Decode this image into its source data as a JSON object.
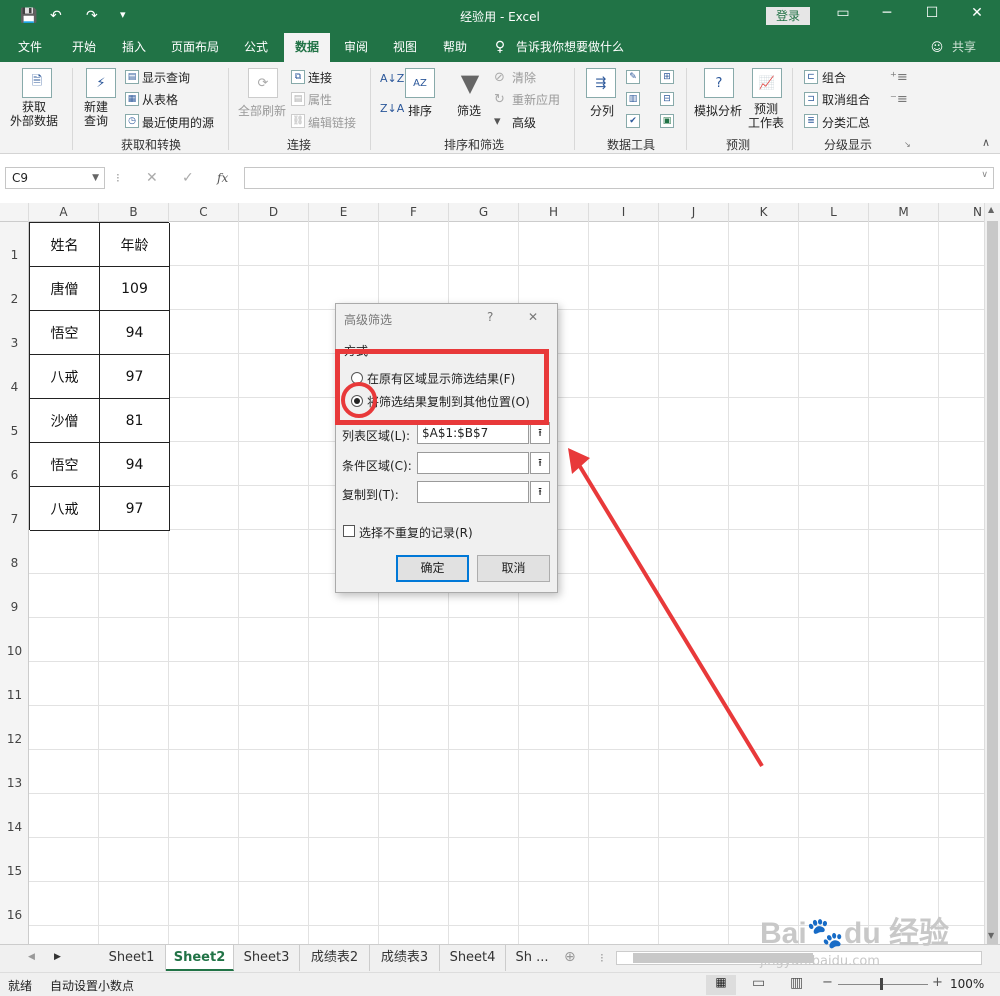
{
  "window": {
    "title": "经验用 - Excel",
    "login": "登录"
  },
  "tabs": [
    "文件",
    "开始",
    "插入",
    "页面布局",
    "公式",
    "数据",
    "审阅",
    "视图",
    "帮助"
  ],
  "tell_me": "告诉我你想要做什么",
  "share": "共享",
  "ribbon": {
    "get_external": "获取\n外部数据",
    "new_query": "新建\n查询",
    "show_queries": "显示查询",
    "from_table": "从表格",
    "recent_sources": "最近使用的源",
    "group_get_transform": "获取和转换",
    "refresh_all": "全部刷新",
    "connections": "连接",
    "properties": "属性",
    "edit_links": "编辑链接",
    "group_connections": "连接",
    "sort": "排序",
    "filter": "筛选",
    "clear": "清除",
    "reapply": "重新应用",
    "advanced": "高级",
    "group_sort_filter": "排序和筛选",
    "text_to_columns": "分列",
    "group_data_tools": "数据工具",
    "what_if": "模拟分析",
    "forecast_sheet": "预测\n工作表",
    "group_forecast": "预测",
    "group": "组合",
    "ungroup": "取消组合",
    "subtotal": "分类汇总",
    "group_outline": "分级显示"
  },
  "formula_bar": {
    "name_box": "C9",
    "fx": "fx",
    "value": ""
  },
  "columns": [
    "A",
    "B",
    "C",
    "D",
    "E",
    "F",
    "G",
    "H",
    "I",
    "J",
    "K",
    "L",
    "M",
    "N"
  ],
  "rows": [
    "1",
    "2",
    "3",
    "4",
    "5",
    "6",
    "7",
    "8",
    "9",
    "10",
    "11",
    "12",
    "13",
    "14",
    "15",
    "16"
  ],
  "table": {
    "headers": [
      "姓名",
      "年龄"
    ],
    "rows": [
      [
        "唐僧",
        "109"
      ],
      [
        "悟空",
        "94"
      ],
      [
        "八戒",
        "97"
      ],
      [
        "沙僧",
        "81"
      ],
      [
        "悟空",
        "94"
      ],
      [
        "八戒",
        "97"
      ]
    ]
  },
  "dialog": {
    "title": "高级筛选",
    "help": "?",
    "close": "✕",
    "section": "方式",
    "option_inplace": "在原有区域显示筛选结果(F)",
    "option_copy": "将筛选结果复制到其他位置(O)",
    "selected_option": "option_copy",
    "list_range_label": "列表区域(L):",
    "list_range_value": "$A$1:$B$7",
    "criteria_label": "条件区域(C):",
    "criteria_value": "",
    "copy_to_label": "复制到(T):",
    "copy_to_value": "",
    "unique_label": "选择不重复的记录(R)",
    "unique_checked": false,
    "ok": "确定",
    "cancel": "取消"
  },
  "sheets": [
    "Sheet1",
    "Sheet2",
    "Sheet3",
    "成绩表2",
    "成绩表3",
    "Sheet4",
    "Sh ..."
  ],
  "active_sheet": "Sheet2",
  "status": {
    "ready": "就绪",
    "auto_decimal": "自动设置小数点",
    "zoom": "100%"
  },
  "accent_color": "#217346",
  "annotation_color": "#e8393a",
  "watermark": "Bai du 经验\njingyan.baidu.com"
}
